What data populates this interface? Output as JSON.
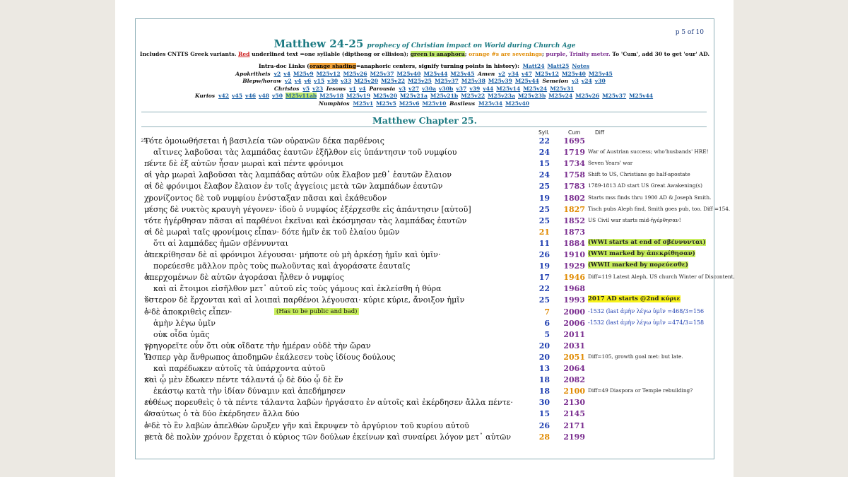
{
  "page": {
    "page_number": "p 5 of 10",
    "title": "Matthew 24-25",
    "subtitle": "prophecy of Christian impact on World during Church Age",
    "legend": {
      "part1": "Includes CNTTS Greek variants.",
      "red": "Red",
      "part2": "underlined text =one syllable (dipthong or ellision);",
      "green": "green is anaphora",
      "part3": ";",
      "orange": "orange #s are sevenings",
      "part4": ";",
      "purple": "purple, Trinity meter.",
      "part5": "To 'Cum', add 30 to get 'our' AD."
    },
    "intradoc": {
      "label": "Intra-doc Links (",
      "orange": "orange shading",
      "label2": "=anaphoric centers, signify turning points in history):",
      "links": [
        "Matt24",
        "Matt25",
        "Notes"
      ]
    },
    "link_rows": [
      {
        "label": "Apokritheis",
        "links": [
          "v2",
          "v4",
          "M25v9",
          "M25v12",
          "M25v26",
          "M25v37",
          "M25v40",
          "M25v44",
          "M25v45"
        ],
        "label2": "Amen",
        "links2": [
          "v2",
          "v34",
          "v47",
          "M25v12",
          "M25v40",
          "M25v45"
        ]
      },
      {
        "label": "Blepw/horaw",
        "links": [
          "v2",
          "v4",
          "v6",
          "v15",
          "v30",
          "v33",
          "M25v20",
          "M25v22",
          "M25v25",
          "M25v37",
          "M25v38",
          "M25v39",
          "M25v44"
        ],
        "label2": "Semeion",
        "links2": [
          "v3",
          "v24",
          "v30"
        ]
      },
      {
        "label": "Christos",
        "links": [
          "v5",
          "v23"
        ],
        "label2": "Iesous",
        "links2": [
          "v1",
          "v4"
        ],
        "label3": "Parousia",
        "links3": [
          "v3",
          "v27",
          "v30a",
          "v30b",
          "v37",
          "v39",
          "v44",
          "M25v14",
          "M25v24",
          "M25v31"
        ]
      },
      {
        "label": "Kurios",
        "links": [
          "v42",
          "v45",
          "v46",
          "v48",
          "v50",
          "M25v11ab",
          "M25v18",
          "M25v19",
          "M25v20",
          "M25v21a",
          "M25v21b",
          "M25v22",
          "M25v23a",
          "M25v23b",
          "M25v24",
          "M25v26",
          "M25v37",
          "M25v44"
        ]
      },
      {
        "label": "Numphios",
        "links": [
          "M25v1",
          "M25v5",
          "M25v6",
          "M25v10"
        ],
        "label2": "Basileus",
        "links2": [
          "M25v34",
          "M25v40"
        ]
      }
    ],
    "chapter": "Matthew Chapter 25.",
    "columns": {
      "syll": "Syll.",
      "cum": "Cum",
      "diff": "Diff"
    }
  },
  "rows": [
    {
      "v": "25:1",
      "t": "Τότε ὁμοιωθήσεται ἡ βασιλεία τῶν οὐρανῶν δέκα παρθένοις",
      "s": "22",
      "c": "1695",
      "n": ""
    },
    {
      "v": "",
      "t": "αἵτινες λαβοῦσαι τὰς λαμπάδας ἑαυτῶν ἐξῆλθον εἰς ὑπάντησιν τοῦ νυμφίου",
      "s": "24",
      "c": "1719",
      "n": "War of Austrian success; who'husbands' HRE!"
    },
    {
      "v": "2",
      "t": "πέντε δὲ ἐξ αὐτῶν ἦσαν μωραὶ καὶ πέντε φρόνιμοι",
      "s": "15",
      "c": "1734",
      "n": "Seven Years' war"
    },
    {
      "v": "3",
      "t": "αἱ γὰρ μωραὶ λαβοῦσαι τὰς λαμπάδας αὐτῶν οὐκ ἔλαβον μεθ᾽ ἑαυτῶν ἔλαιον",
      "s": "24",
      "c": "1758",
      "n": "Shift to US, Christians go half-apostate"
    },
    {
      "v": "4",
      "t": "αἱ δὲ φρόνιμοι ἔλαβον ἔλαιον ἐν τοῖς ἀγγείοις μετὰ τῶν λαμπάδων ἑαυτῶν",
      "s": "25",
      "c": "1783",
      "n": "1789-1813 AD start US Great Awakening(s)"
    },
    {
      "v": "5",
      "t": "χρονίζοντος δὲ τοῦ νυμφίου ἐνύσταξαν πᾶσαι καὶ ἐκάθευδον",
      "s": "19",
      "c": "1802",
      "n": "Starts mss finds thru 1900 AD & Joseph Smith."
    },
    {
      "v": "6",
      "t": "μέσης δὲ νυκτὸς κραυγὴ γέγονεν· ἰδοὺ ὁ νυμφίος ἐξέρχεσθε εἰς ἀπάντησιν [αὐτοῦ]",
      "s": "25",
      "c": "1827",
      "n": "Tisch pubs Aleph find, Smith goes pub, too. Diff =154."
    },
    {
      "v": "7",
      "t": "τότε ἠγέρθησαν πᾶσαι αἱ παρθένοι ἐκεῖναι καὶ ἐκόσμησαν τὰς λαμπάδας ἑαυτῶν",
      "s": "25",
      "c": "1852",
      "n": "US Civil war starts mid-ἠγέρθησαν!"
    },
    {
      "v": "8",
      "t": "αἱ δὲ μωραὶ ταῖς φρονίμοις εἶπαν· δότε ἡμῖν ἐκ τοῦ ἐλαίου ὑμῶν",
      "s": "21",
      "c": "1873",
      "n": ""
    },
    {
      "v": "",
      "t": "ὅτι αἱ λαμπάδες ἡμῶν σβέννυνται",
      "s": "11",
      "c": "1884",
      "n": "(WWI starts at end of σβέννυνται)"
    },
    {
      "v": "9",
      "t": "ἀπεκρίθησαν δὲ αἱ φρόνιμοι λέγουσαι· μήποτε οὐ μὴ ἀρκέσῃ ἡμῖν καὶ ὑμῖν·",
      "s": "26",
      "c": "1910",
      "n": "(WWI marked by ἀπεκρίθησαν)"
    },
    {
      "v": "",
      "t": "πορεύεσθε μᾶλλον πρὸς τοὺς πωλοῦντας καὶ ἀγοράσατε ἑαυταῖς",
      "s": "19",
      "c": "1929",
      "n": "(WWII marked by πορεύεσθε)"
    },
    {
      "v": "10",
      "t": "ἀπερχομένων δὲ αὐτῶν ἀγοράσαι ἦλθεν ὁ νυμφίος",
      "s": "17",
      "c": "1946",
      "n": "Diff=119 Latest Aleph, US church Winter of Discontent."
    },
    {
      "v": "",
      "t": "καὶ αἱ ἕτοιμοι εἰσῆλθον μετ᾽ αὐτοῦ εἰς τοὺς γάμους καὶ ἐκλείσθη ἡ θύρα",
      "s": "22",
      "c": "1968",
      "n": ""
    },
    {
      "v": "11",
      "t": "ὕστερον δὲ ἔρχονται καὶ αἱ λοιπαὶ παρθένοι λέγουσαι· κύριε κύριε, ἄνοιξον ἡμῖν",
      "s": "25",
      "c": "1993",
      "n": "2017 AD starts @2nd κύριε"
    },
    {
      "v": "12",
      "t": "ὁ δὲ ἀποκριθεὶς εἶπεν·",
      "s": "7",
      "c": "2000",
      "n": "-1532 (last ἀμὴν λέγω ὑμῖν =468/3=156",
      "aside": "(Has to be public and bad)"
    },
    {
      "v": "",
      "t": "ἀμὴν λέγω ὑμῖν",
      "s": "6",
      "c": "2006",
      "n": "-1532 (last ἀμὴν λέγω ὑμῖν =474/3=158"
    },
    {
      "v": "",
      "t": "οὐκ οἶδα ὑμᾶς",
      "s": "5",
      "c": "2011",
      "n": ""
    },
    {
      "v": "13",
      "t": "γρηγορεῖτε οὖν ὅτι οὐκ οἴδατε τὴν ἡμέραν οὐδὲ τὴν ὥραν",
      "s": "20",
      "c": "2031",
      "n": ""
    },
    {
      "v": "14",
      "t": "Ὥσπερ γὰρ ἄνθρωπος ἀποδημῶν ἐκάλεσεν τοὺς ἰδίους δούλους",
      "s": "20",
      "c": "2051",
      "n": "Diff=105, growth goal met: but late."
    },
    {
      "v": "",
      "t": "καὶ παρέδωκεν αὐτοῖς τὰ ὑπάρχοντα αὐτοῦ",
      "s": "13",
      "c": "2064",
      "n": ""
    },
    {
      "v": "15",
      "t": "καὶ ᾧ μὲν ἔδωκεν πέντε τάλαντά ᾧ δὲ δύο ᾧ δὲ ἕν",
      "s": "18",
      "c": "2082",
      "n": ""
    },
    {
      "v": "",
      "t": "ἑκάστῳ κατὰ τὴν ἰδίαν δύναμιν καὶ ἀπεδήμησεν",
      "s": "18",
      "c": "2100",
      "n": "Diff=49 Diaspora or Temple rebuilding?"
    },
    {
      "v": "16",
      "t": "εὐθέως πορευθεὶς ὁ τὰ πέντε τάλαντα λαβὼν ἠργάσατο ἐν αὐτοῖς καὶ ἐκέρδησεν ἄλλα πέντε·",
      "s": "30",
      "c": "2130",
      "n": ""
    },
    {
      "v": "17",
      "t": "ὡσαύτως ὁ τὰ δύο ἐκέρδησεν ἄλλα δύο",
      "s": "15",
      "c": "2145",
      "n": ""
    },
    {
      "v": "18",
      "t": "ὁ δὲ τὸ ἓν λαβὼν ἀπελθὼν ὤρυξεν γῆν καὶ ἔκρυψεν τὸ ἀργύριον τοῦ κυρίου αὐτοῦ",
      "s": "26",
      "c": "2171",
      "n": ""
    },
    {
      "v": "19",
      "t": "μετὰ δὲ πολὺν χρόνον ἔρχεται ὁ κύριος τῶν δούλων ἐκείνων καὶ συναίρει λόγον μετ᾽ αὐτῶν",
      "s": "28",
      "c": "2199",
      "n": ""
    }
  ],
  "colors": {
    "accent": "#1b7a82",
    "syll_blue": "#1f3eb0",
    "cum_purple": "#7a2e8f",
    "orange": "#e08a00",
    "red": "#cc1a1a",
    "green_hl": "#c9ee5e",
    "yellow_hl": "#f7f21a",
    "link_blue": "#1a5fa5"
  }
}
